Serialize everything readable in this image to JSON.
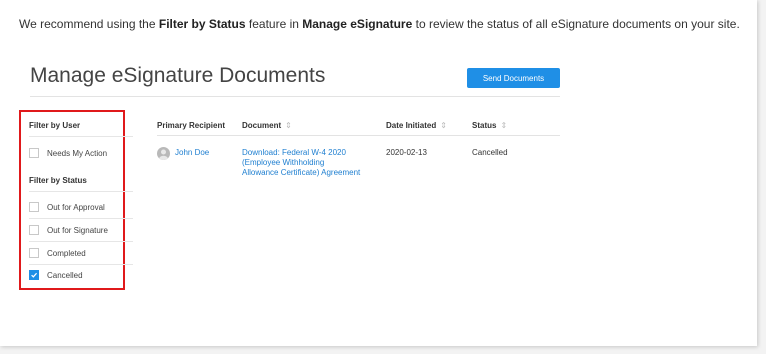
{
  "intro": {
    "prefix": "We recommend using the ",
    "feature": "Filter by Status",
    "middle": " feature in ",
    "location": "Manage eSignature",
    "suffix": " to review the status of all eSignature documents on your site."
  },
  "page": {
    "title": "Manage eSignature Documents",
    "send_button": "Send Documents"
  },
  "filters": {
    "by_user_heading": "Filter by User",
    "user_options": [
      {
        "label": "Needs My Action",
        "checked": false
      }
    ],
    "by_status_heading": "Filter by Status",
    "status_options": [
      {
        "label": "Out for Approval",
        "checked": false
      },
      {
        "label": "Out for Signature",
        "checked": false
      },
      {
        "label": "Completed",
        "checked": false
      },
      {
        "label": "Cancelled",
        "checked": true
      }
    ],
    "highlight_color": "#e0191b"
  },
  "table": {
    "headers": {
      "recipient": "Primary Recipient",
      "document": "Document",
      "date": "Date Initiated",
      "status": "Status"
    },
    "sort_icon": "⇕",
    "rows": [
      {
        "recipient": "John Doe",
        "document_line1": "Download: Federal W-4 2020",
        "document_line2": "(Employee Withholding",
        "document_line3": "Allowance Certificate) Agreement",
        "date": "2020-02-13",
        "status": "Cancelled"
      }
    ]
  },
  "colors": {
    "accent": "#1f8fe6",
    "link": "#1f7fd0"
  }
}
